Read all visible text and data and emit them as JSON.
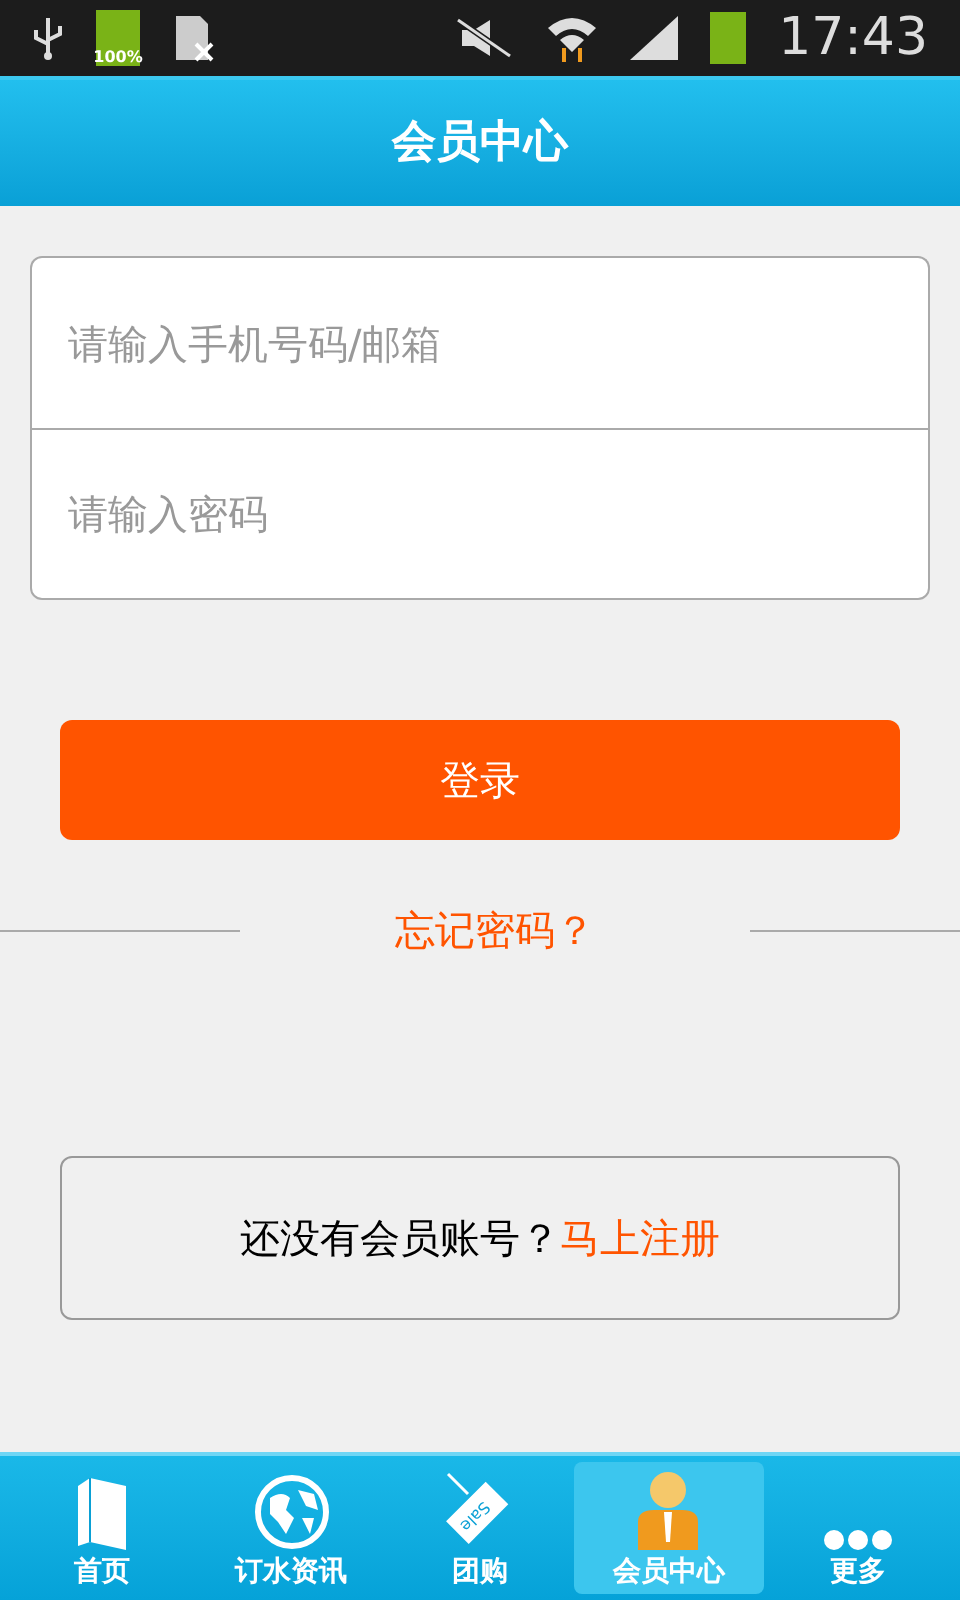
{
  "status_bar": {
    "battery_text": "100%",
    "time": "17:43"
  },
  "header": {
    "title": "会员中心"
  },
  "form": {
    "fields": [
      {
        "placeholder": "请输入手机号码/邮箱"
      },
      {
        "placeholder": "请输入密码"
      }
    ]
  },
  "login_button": "登录",
  "forgot_link": "忘记密码？",
  "register": {
    "text": "还没有会员账号？",
    "link": "马上注册"
  },
  "tabs": [
    {
      "label": "首页",
      "kind": "book",
      "selected": false
    },
    {
      "label": "订水资讯",
      "kind": "globe",
      "selected": false
    },
    {
      "label": "团购",
      "kind": "tag",
      "icon_text": "Sale",
      "selected": false
    },
    {
      "label": "会员中心",
      "kind": "person",
      "selected": true
    },
    {
      "label": "更多",
      "kind": "dots",
      "selected": false
    }
  ]
}
